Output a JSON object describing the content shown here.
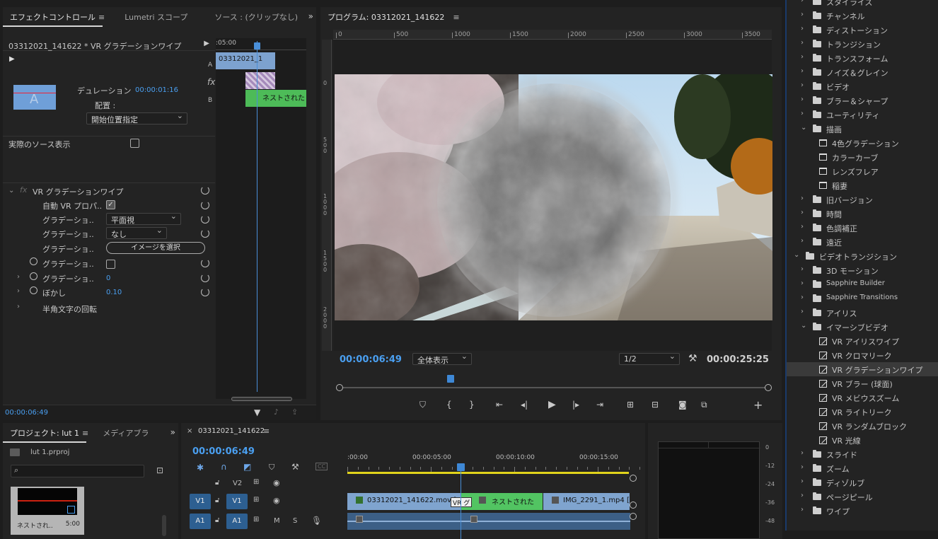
{
  "effect_controls": {
    "tabs": [
      "エフェクトコントロール",
      "Lumetri スコープ",
      "ソース : (クリップなし)"
    ],
    "tab_menu_glyph": "≡",
    "clip_header": "03312021_141622 * VR グラデーションワイプ",
    "duration_label": "デュレーション",
    "duration_value": "00:00:01:16",
    "alignment_label": "配置 :",
    "alignment_value": "開始位置指定",
    "show_actual_sources_label": "実際のソース表示",
    "mini_timeline": {
      "time_label": ":05:00",
      "clip_a_label": "03312021_1",
      "clip_b_label": "ネストされた",
      "track_a": "A",
      "track_b": "B",
      "fx_label": "fx"
    },
    "effect_name": "VR グラデーションワイプ",
    "params": [
      {
        "label": "自動 VR プロパ..",
        "type": "checkbox",
        "checked": true
      },
      {
        "label": "グラデーショ..",
        "type": "dropdown",
        "value": "平面視"
      },
      {
        "label": "グラデーショ..",
        "type": "dropdown",
        "value": "なし"
      },
      {
        "label": "グラデーショ..",
        "type": "button",
        "value": "イメージを選択"
      },
      {
        "label": "グラデーショ..",
        "type": "checkbox",
        "checked": false
      },
      {
        "label": "グラデーショ..",
        "type": "number",
        "value": "0"
      },
      {
        "label": "ぼかし",
        "type": "number",
        "value": "0.10"
      },
      {
        "label": "半角文字の回転",
        "type": "group",
        "value": ""
      }
    ],
    "footer_time": "00:00:06:49"
  },
  "program_monitor": {
    "title": "プログラム: 03312021_141622",
    "ruler_labels": [
      "0",
      "500",
      "1000",
      "1500",
      "2000",
      "2500",
      "3000",
      "3500"
    ],
    "vruler_labels": [
      "0",
      "500",
      "1000",
      "1500",
      "2000"
    ],
    "current_time": "00:00:06:49",
    "fit_value": "全体表示",
    "resolution_value": "1/2",
    "duration": "00:00:25:25",
    "playhead_fraction": 0.26
  },
  "effects_panel": {
    "items": [
      {
        "label": "スタイライズ",
        "level": 1,
        "kind": "folder",
        "expanded": false
      },
      {
        "label": "チャンネル",
        "level": 1,
        "kind": "folder",
        "expanded": false
      },
      {
        "label": "ディストーション",
        "level": 1,
        "kind": "folder",
        "expanded": false
      },
      {
        "label": "トランジション",
        "level": 1,
        "kind": "folder",
        "expanded": false
      },
      {
        "label": "トランスフォーム",
        "level": 1,
        "kind": "folder",
        "expanded": false
      },
      {
        "label": "ノイズ＆グレイン",
        "level": 1,
        "kind": "folder",
        "expanded": false
      },
      {
        "label": "ビデオ",
        "level": 1,
        "kind": "folder",
        "expanded": false
      },
      {
        "label": "ブラー＆シャープ",
        "level": 1,
        "kind": "folder",
        "expanded": false
      },
      {
        "label": "ユーティリティ",
        "level": 1,
        "kind": "folder",
        "expanded": false
      },
      {
        "label": "描画",
        "level": 1,
        "kind": "folder",
        "expanded": true
      },
      {
        "label": "4色グラデーション",
        "level": 2,
        "kind": "cal"
      },
      {
        "label": "カラーカーブ",
        "level": 2,
        "kind": "cal"
      },
      {
        "label": "レンズフレア",
        "level": 2,
        "kind": "cal"
      },
      {
        "label": "稲妻",
        "level": 2,
        "kind": "cal"
      },
      {
        "label": "旧バージョン",
        "level": 1,
        "kind": "folder",
        "expanded": false
      },
      {
        "label": "時間",
        "level": 1,
        "kind": "folder",
        "expanded": false
      },
      {
        "label": "色調補正",
        "level": 1,
        "kind": "folder",
        "expanded": false
      },
      {
        "label": "遠近",
        "level": 1,
        "kind": "folder",
        "expanded": false
      },
      {
        "label": "ビデオトランジション",
        "level": 0,
        "kind": "folder",
        "expanded": true
      },
      {
        "label": "3D モーション",
        "level": 1,
        "kind": "folder",
        "expanded": false
      },
      {
        "label": "Sapphire Builder",
        "level": 1,
        "kind": "folder",
        "expanded": false
      },
      {
        "label": "Sapphire Transitions",
        "level": 1,
        "kind": "folder",
        "expanded": false
      },
      {
        "label": "アイリス",
        "level": 1,
        "kind": "folder",
        "expanded": false
      },
      {
        "label": "イマーシブビデオ",
        "level": 1,
        "kind": "folder",
        "expanded": true
      },
      {
        "label": "VR アイリスワイプ",
        "level": 2,
        "kind": "fx"
      },
      {
        "label": "VR クロマリーク",
        "level": 2,
        "kind": "fx"
      },
      {
        "label": "VR グラデーションワイプ",
        "level": 2,
        "kind": "fx",
        "selected": true
      },
      {
        "label": "VR ブラー (球面)",
        "level": 2,
        "kind": "fx"
      },
      {
        "label": "VR メビウスズーム",
        "level": 2,
        "kind": "fx"
      },
      {
        "label": "VR ライトリーク",
        "level": 2,
        "kind": "fx"
      },
      {
        "label": "VR ランダムブロック",
        "level": 2,
        "kind": "fx"
      },
      {
        "label": "VR 光線",
        "level": 2,
        "kind": "fx"
      },
      {
        "label": "スライド",
        "level": 1,
        "kind": "folder",
        "expanded": false
      },
      {
        "label": "ズーム",
        "level": 1,
        "kind": "folder",
        "expanded": false
      },
      {
        "label": "ディゾルブ",
        "level": 1,
        "kind": "folder",
        "expanded": false
      },
      {
        "label": "ページピール",
        "level": 1,
        "kind": "folder",
        "expanded": false
      },
      {
        "label": "ワイプ",
        "level": 1,
        "kind": "folder",
        "expanded": false
      }
    ]
  },
  "project_panel": {
    "tabs": [
      "プロジェクト: lut 1",
      "メディアブラ"
    ],
    "tab_menu_glyph": "≡",
    "file_name": "lut 1.prproj",
    "search_placeholder": "",
    "thumb_label": "ネストされ..",
    "thumb_duration": "5:00"
  },
  "timeline": {
    "sequence_name": "03312021_141622",
    "sequence_menu_glyph": "≡",
    "current_time": "00:00:06:49",
    "ruler_labels": [
      ":00:00",
      "00:00:05:00",
      "00:00:10:00",
      "00:00:15:00"
    ],
    "tracks": [
      {
        "name": "V2",
        "target": "",
        "toggles": [
          "M-cam",
          "eye"
        ]
      },
      {
        "name": "V1",
        "target": "V1",
        "toggles": [
          "M-cam",
          "eye"
        ]
      },
      {
        "name": "A1",
        "target": "A1",
        "toggles": [
          "M",
          "S",
          "mic"
        ]
      }
    ],
    "clips": [
      {
        "label": "03312021_141622.mov [",
        "track": "V1"
      },
      {
        "label": "ネストされた",
        "track": "V1"
      },
      {
        "label": "IMG_2291_1.mp4 [",
        "track": "V1"
      }
    ],
    "transition_label": "VR グ",
    "playhead_fraction": 0.4
  },
  "audio_meter": {
    "db_labels": [
      "0",
      "-12",
      "-24",
      "-36",
      "-48"
    ]
  }
}
